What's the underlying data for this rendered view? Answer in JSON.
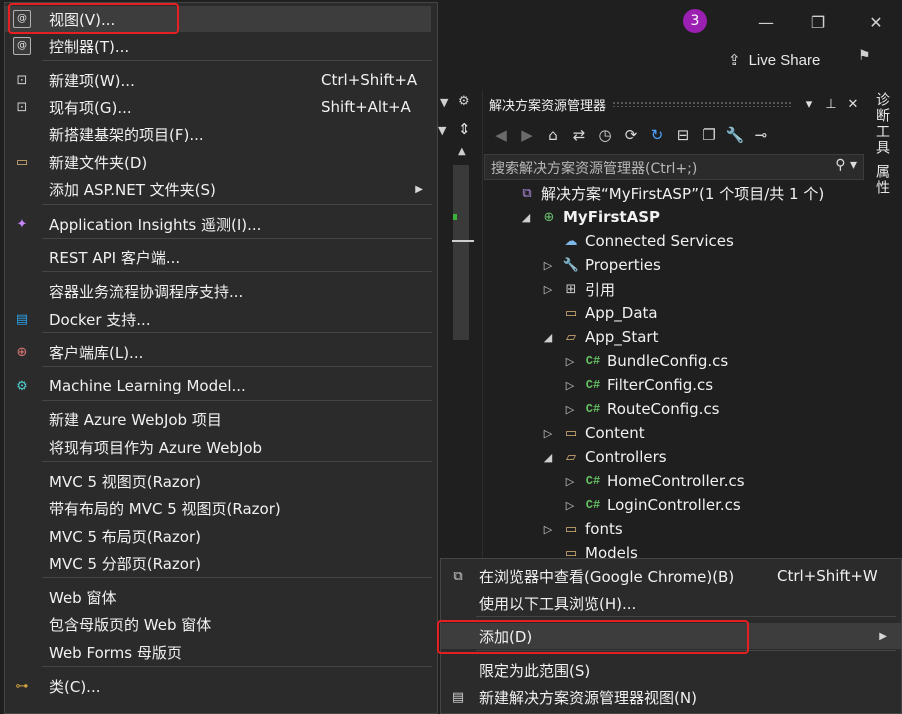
{
  "titlebar": {
    "notification_count": "3",
    "live_share_label": "Live Share"
  },
  "solution_explorer": {
    "title": "解决方案资源管理器",
    "search_placeholder": "搜索解决方案资源管理器(Ctrl+;)",
    "tree": [
      {
        "label": "解决方案“MyFirstASP”(1 个项目/共 1 个)",
        "icon": "solution-icon",
        "expanded": null
      },
      {
        "label": "MyFirstASP",
        "icon": "web-project-icon",
        "expanded": true
      },
      {
        "label": "Connected Services",
        "icon": "connected-services-icon",
        "expanded": null
      },
      {
        "label": "Properties",
        "icon": "wrench-icon",
        "expanded": false
      },
      {
        "label": "引用",
        "icon": "references-icon",
        "expanded": false
      },
      {
        "label": "App_Data",
        "icon": "folder-icon",
        "expanded": null
      },
      {
        "label": "App_Start",
        "icon": "folder-open-icon",
        "expanded": true
      },
      {
        "label": "BundleConfig.cs",
        "icon": "csharp-file-icon",
        "expanded": false
      },
      {
        "label": "FilterConfig.cs",
        "icon": "csharp-file-icon",
        "expanded": false
      },
      {
        "label": "RouteConfig.cs",
        "icon": "csharp-file-icon",
        "expanded": false
      },
      {
        "label": "Content",
        "icon": "folder-icon",
        "expanded": false
      },
      {
        "label": "Controllers",
        "icon": "folder-open-icon",
        "expanded": true
      },
      {
        "label": "HomeController.cs",
        "icon": "csharp-file-icon",
        "expanded": false
      },
      {
        "label": "LoginController.cs",
        "icon": "csharp-file-icon",
        "expanded": false
      },
      {
        "label": "fonts",
        "icon": "folder-icon",
        "expanded": false
      },
      {
        "label": "Models",
        "icon": "folder-icon",
        "expanded": null
      }
    ]
  },
  "side_tabs": [
    "诊断工具",
    "属性"
  ],
  "add_submenu": {
    "items": [
      {
        "label": "视图(V)...",
        "shortcut": "",
        "icon": "view-icon"
      },
      {
        "label": "控制器(T)...",
        "shortcut": "",
        "icon": "controller-icon"
      },
      {
        "label": "新建项(W)...",
        "shortcut": "Ctrl+Shift+A",
        "icon": "new-item-icon"
      },
      {
        "label": "现有项(G)...",
        "shortcut": "Shift+Alt+A",
        "icon": "existing-item-icon"
      },
      {
        "label": "新搭建基架的项目(F)...",
        "shortcut": "",
        "icon": ""
      },
      {
        "label": "新建文件夹(D)",
        "shortcut": "",
        "icon": "new-folder-icon"
      },
      {
        "label": "添加 ASP.NET 文件夹(S)",
        "shortcut": "",
        "icon": ""
      },
      {
        "label": "Application Insights 遥测(I)...",
        "shortcut": "",
        "icon": "insights-icon"
      },
      {
        "label": "REST API 客户端...",
        "shortcut": "",
        "icon": ""
      },
      {
        "label": "容器业务流程协调程序支持...",
        "shortcut": "",
        "icon": ""
      },
      {
        "label": "Docker 支持...",
        "shortcut": "",
        "icon": "docker-icon"
      },
      {
        "label": "客户端库(L)...",
        "shortcut": "",
        "icon": "client-library-icon"
      },
      {
        "label": "Machine Learning Model...",
        "shortcut": "",
        "icon": "ml-icon"
      },
      {
        "label": "新建 Azure WebJob 项目",
        "shortcut": "",
        "icon": ""
      },
      {
        "label": "将现有项目作为 Azure WebJob",
        "shortcut": "",
        "icon": ""
      },
      {
        "label": "MVC 5 视图页(Razor)",
        "shortcut": "",
        "icon": ""
      },
      {
        "label": "带有布局的 MVC 5 视图页(Razor)",
        "shortcut": "",
        "icon": ""
      },
      {
        "label": "MVC 5 布局页(Razor)",
        "shortcut": "",
        "icon": ""
      },
      {
        "label": "MVC 5 分部页(Razor)",
        "shortcut": "",
        "icon": ""
      },
      {
        "label": "Web 窗体",
        "shortcut": "",
        "icon": ""
      },
      {
        "label": "包含母版页的 Web 窗体",
        "shortcut": "",
        "icon": ""
      },
      {
        "label": "Web Forms 母版页",
        "shortcut": "",
        "icon": ""
      },
      {
        "label": "类(C)...",
        "shortcut": "",
        "icon": "class-icon"
      }
    ]
  },
  "folder_context_menu": {
    "items": [
      {
        "label": "在浏览器中查看(Google Chrome)(B)",
        "shortcut": "Ctrl+Shift+W",
        "icon": "browser-view-icon"
      },
      {
        "label": "使用以下工具浏览(H)...",
        "shortcut": "",
        "icon": ""
      },
      {
        "label": "添加(D)",
        "shortcut": "",
        "icon": ""
      },
      {
        "label": "限定为此范围(S)",
        "shortcut": "",
        "icon": ""
      },
      {
        "label": "新建解决方案资源管理器视图(N)",
        "shortcut": "",
        "icon": "new-explorer-view-icon"
      }
    ]
  },
  "colors": {
    "background": "#1f1f1f",
    "menu_bg": "#2b2b2b",
    "highlight_frame": "#e52020",
    "badge": "#9b1fb0",
    "folder": "#dcb67a",
    "csharp": "#66c266"
  }
}
